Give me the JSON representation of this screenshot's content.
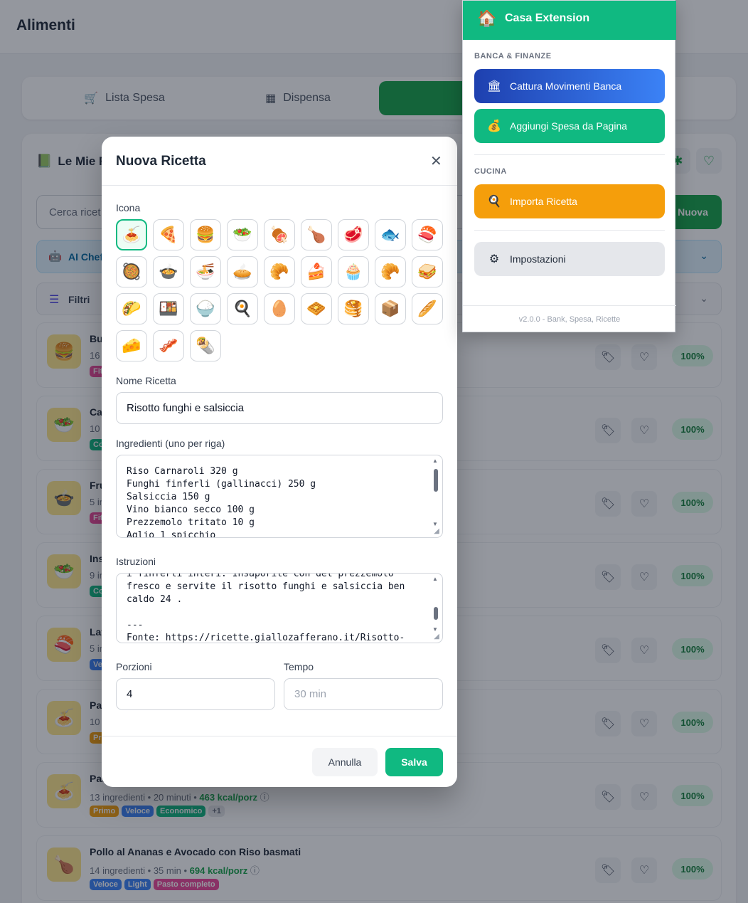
{
  "page": {
    "title": "Alimenti"
  },
  "tabs": [
    {
      "label": "Lista Spesa",
      "icon": "cart-icon"
    },
    {
      "label": "Dispensa",
      "icon": "pantry-icon"
    },
    {
      "label": "",
      "icon": "book-icon"
    }
  ],
  "panel": {
    "title": "Le Mie R",
    "search_placeholder": "Cerca ricet",
    "new_button": "Nuova",
    "ai_chef": "AI Chef",
    "filters": "Filtri"
  },
  "recipes": [
    {
      "name": "Bu",
      "meta": "16",
      "tags": [
        {
          "label": "Fit",
          "color": "pink"
        }
      ],
      "emoji": "🍔",
      "pct": "100%"
    },
    {
      "name": "Ca",
      "meta": "10",
      "tags": [
        {
          "label": "Co",
          "color": "green"
        }
      ],
      "emoji": "🥗",
      "pct": "100%"
    },
    {
      "name": "Fru",
      "meta": "5 in",
      "tags": [
        {
          "label": "Fit",
          "color": "pink"
        }
      ],
      "emoji": "🍲",
      "pct": "100%"
    },
    {
      "name": "Ins",
      "meta": "9 in",
      "tags": [
        {
          "label": "Co",
          "color": "green"
        }
      ],
      "emoji": "🥗",
      "pct": "100%"
    },
    {
      "name": "Lat",
      "meta": "5 in",
      "tags": [
        {
          "label": "Ve",
          "color": "blue"
        }
      ],
      "emoji": "🍣",
      "pct": "100%"
    },
    {
      "name": "Pas",
      "meta": "10",
      "tags": [
        {
          "label": "Pr",
          "color": "orange"
        }
      ],
      "emoji": "🍝",
      "pct": "100%"
    },
    {
      "name": "Pas",
      "meta_count": "13 ingredienti",
      "meta_time": "20 minuti",
      "meta_kcal": "463 kcal/porz",
      "tags": [
        {
          "label": "Primo",
          "color": "orange"
        },
        {
          "label": "Veloce",
          "color": "blue"
        },
        {
          "label": "Economico",
          "color": "green"
        },
        {
          "label": "+1",
          "color": "gray"
        }
      ],
      "emoji": "🍝",
      "pct": "100%"
    },
    {
      "name": "Pollo al Ananas e Avocado con Riso basmati",
      "meta_count": "14 ingredienti",
      "meta_time": "35 min",
      "meta_kcal": "694 kcal/porz",
      "tags": [
        {
          "label": "Veloce",
          "color": "blue"
        },
        {
          "label": "Light",
          "color": "blue"
        },
        {
          "label": "Pasto completo",
          "color": "pink"
        }
      ],
      "emoji": "🍗",
      "pct": "100%"
    }
  ],
  "modal": {
    "title": "Nuova Ricetta",
    "icon_label": "Icona",
    "icons": [
      "🍝",
      "🍕",
      "🍔",
      "🥗",
      "🍖",
      "🍗",
      "🥩",
      "🐟",
      "🍣",
      "🥘",
      "🍲",
      "🍜",
      "🥧",
      "🥐",
      "🍰",
      "🧁",
      "🥐",
      "🥪",
      "🌮",
      "🍱",
      "🍚",
      "🍳",
      "🥚",
      "🧇",
      "🥞",
      "📦",
      "🥖",
      "🧀",
      "🥓",
      "🌯"
    ],
    "selected_icon": 0,
    "name_label": "Nome Ricetta",
    "name_value": "Risotto funghi e salsiccia",
    "ingredients_label": "Ingredienti (uno per riga)",
    "ingredients_value": "Riso Carnaroli 320 g\nFunghi finferli (gallinacci) 250 g\nSalsiccia 150 g\nVino bianco secco 100 g\nPrezzemolo tritato 10 g\nAglio 1 spicchio",
    "instructions_label": "Istruzioni",
    "instructions_value": "i finferli interi. Insaporite con del prezzemolo\nfresco e servite il risotto funghi e salsiccia ben\ncaldo 24 .\n\n---\nFonte: https://ricette.giallozafferano.it/Risotto-",
    "portions_label": "Porzioni",
    "portions_value": "4",
    "time_label": "Tempo",
    "time_placeholder": "30 min",
    "cancel": "Annulla",
    "save": "Salva"
  },
  "extension": {
    "title": "Casa Extension",
    "section_bank": "BANCA & FINANZE",
    "btn_bank": "Cattura Movimenti Banca",
    "btn_expense": "Aggiungi Spesa da Pagina",
    "section_kitchen": "CUCINA",
    "btn_recipe": "Importa Ricetta",
    "btn_settings": "Impostazioni",
    "footer": "v2.0.0 - Bank, Spesa, Ricette"
  }
}
